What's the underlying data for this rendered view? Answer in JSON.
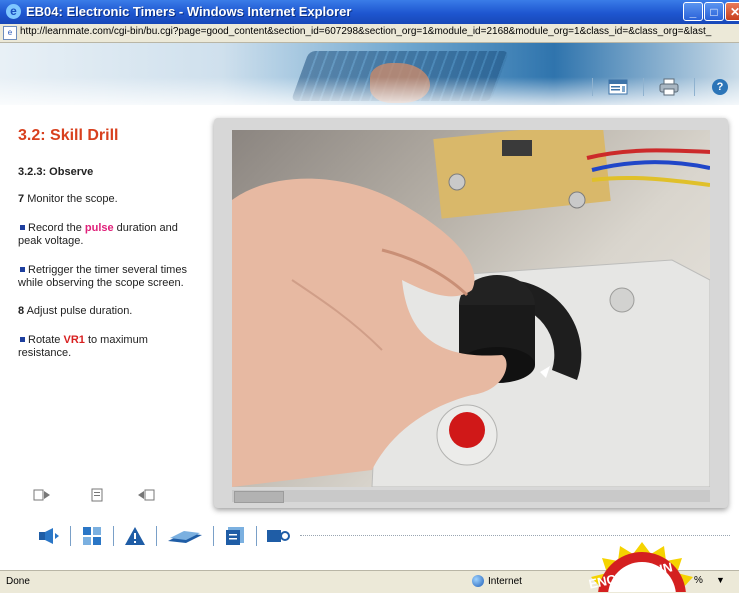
{
  "window": {
    "title": "EB04: Electronic Timers - Windows Internet Explorer",
    "url": "http://learnmate.com/cgi-bin/bu.cgi?page=good_content&section_id=607298&section_org=1&module_id=2168&module_org=1&class_id=&class_org=&last_"
  },
  "lesson": {
    "title": "3.2: Skill Drill",
    "subtitle": "3.2.3: Observe",
    "step7_num": "7",
    "step7_text": "Monitor the scope.",
    "b1_pre": "Record the",
    "b1_hl": "pulse",
    "b1_post": "duration and peak voltage.",
    "b2_text": "Retrigger the timer several times while observing the scope screen.",
    "step8_num": "8",
    "step8_text": "Adjust pulse duration.",
    "b3_pre": "Rotate",
    "b3_hl": "VR1",
    "b3_post": "to maximum resistance."
  },
  "status": {
    "left": "Done",
    "zone": "Internet",
    "zoom": "%"
  },
  "badge": {
    "text": "ENCE·TECHN"
  },
  "icons": {
    "banner": [
      "notes-icon",
      "print-icon",
      "help-icon"
    ],
    "nav": [
      "back-icon",
      "page-icon",
      "forward-icon"
    ],
    "toolbar": [
      "audio-icon",
      "puzzle-icon",
      "warning-icon",
      "book-icon",
      "glossary-icon",
      "video-icon"
    ]
  },
  "colors": {
    "title_bar": "#1e56d0",
    "lesson_title": "#d8401e",
    "highlight_pulse": "#e0207a",
    "highlight_vr1": "#d82020",
    "bullet": "#1e3f9e"
  }
}
